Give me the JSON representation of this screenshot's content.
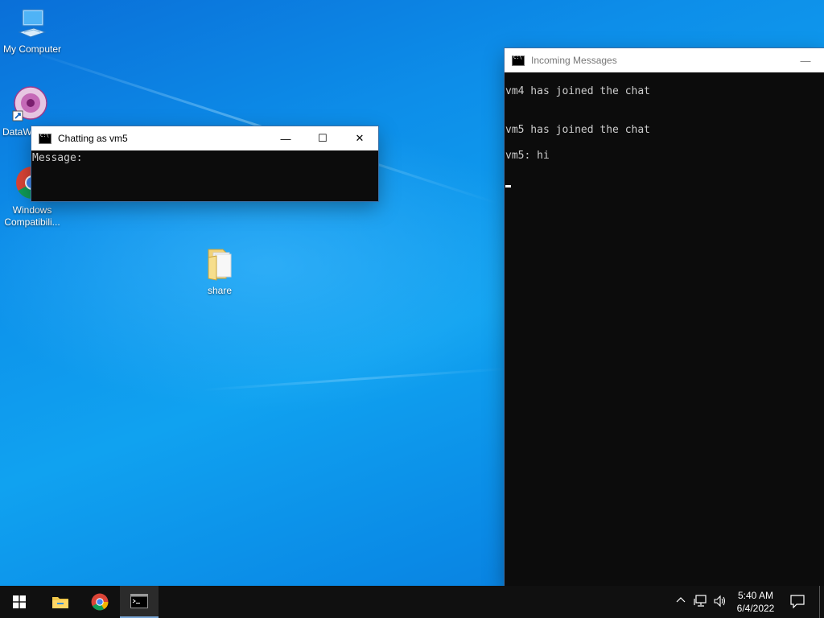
{
  "desktop": {
    "icons": [
      {
        "label": "My Computer",
        "icon": "computer-icon"
      },
      {
        "label": "DataW",
        "icon": "datawrapper-icon"
      },
      {
        "label": "Windows Compatibili...",
        "icon": "chrome-icon"
      },
      {
        "label": "share",
        "icon": "folder-icon"
      }
    ]
  },
  "chat_window": {
    "title": "Chatting as vm5",
    "prompt": "Message:",
    "minimize": "—",
    "maximize": "☐",
    "close": "✕"
  },
  "messages_window": {
    "title": "Incoming Messages",
    "minimize": "—",
    "lines": [
      "vm4 has joined the chat",
      "vm5 has joined the chat",
      "vm5: hi"
    ]
  },
  "taskbar": {
    "start_icon": "windows-start-icon",
    "pinned": [
      "file-explorer-icon",
      "chrome-icon",
      "command-prompt-icon"
    ],
    "tray": {
      "time": "5:40 AM",
      "date": "6/4/2022"
    }
  }
}
